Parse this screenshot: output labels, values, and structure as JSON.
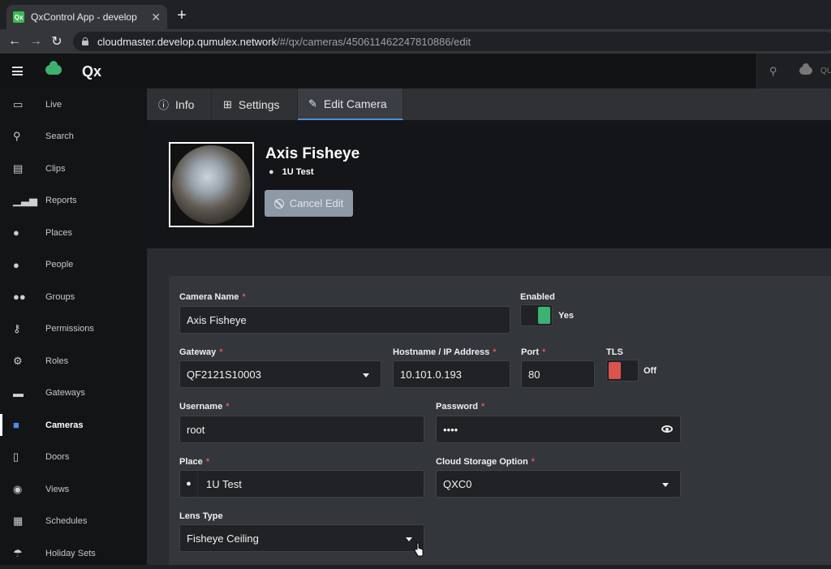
{
  "browser": {
    "tab_title": "QxControl App - develop",
    "tab_close": "✕",
    "new_tab": "+",
    "url_host": "cloudmaster.develop.qumulex.network",
    "url_path": "/#/qx/cameras/450611462247810886/edit"
  },
  "header": {
    "logo_text": "Qx",
    "right_text": "QU"
  },
  "sidebar": {
    "items": [
      {
        "label": "Live",
        "icon": "monitor-icon"
      },
      {
        "label": "Search",
        "icon": "search-icon"
      },
      {
        "label": "Clips",
        "icon": "file-icon"
      },
      {
        "label": "Reports",
        "icon": "chart-icon"
      },
      {
        "label": "Places",
        "icon": "map-pin-icon"
      },
      {
        "label": "People",
        "icon": "person-icon"
      },
      {
        "label": "Groups",
        "icon": "users-icon"
      },
      {
        "label": "Permissions",
        "icon": "key-icon"
      },
      {
        "label": "Roles",
        "icon": "user-cog-icon"
      },
      {
        "label": "Gateways",
        "icon": "hdd-icon"
      },
      {
        "label": "Cameras",
        "icon": "video-icon",
        "active": true
      },
      {
        "label": "Doors",
        "icon": "door-icon"
      },
      {
        "label": "Views",
        "icon": "eye-icon"
      },
      {
        "label": "Schedules",
        "icon": "calendar-icon"
      },
      {
        "label": "Holiday Sets",
        "icon": "umbrella-icon"
      }
    ]
  },
  "tabs": [
    {
      "label": "Info",
      "icon": "info-icon"
    },
    {
      "label": "Settings",
      "icon": "sitemap-icon"
    },
    {
      "label": "Edit Camera",
      "icon": "edit-icon",
      "active": true
    }
  ],
  "camera": {
    "name": "Axis Fisheye",
    "place": "1U Test",
    "cancel_label": "Cancel Edit"
  },
  "form": {
    "camera_name": {
      "label": "Camera Name",
      "value": "Axis Fisheye"
    },
    "enabled": {
      "label": "Enabled",
      "state": "Yes",
      "on": true
    },
    "gateway": {
      "label": "Gateway",
      "value": "QF2121S10003"
    },
    "hostname": {
      "label": "Hostname / IP Address",
      "value": "10.101.0.193"
    },
    "port": {
      "label": "Port",
      "value": "80"
    },
    "tls": {
      "label": "TLS",
      "state": "Off",
      "on": false
    },
    "username": {
      "label": "Username",
      "value": "root"
    },
    "password": {
      "label": "Password",
      "value": "••••"
    },
    "place": {
      "label": "Place",
      "value": "1U Test"
    },
    "cloud_storage": {
      "label": "Cloud Storage Option",
      "value": "QXC0"
    },
    "lens_type": {
      "label": "Lens Type",
      "value": "Fisheye Ceiling"
    },
    "required_mark": "*"
  },
  "colors": {
    "accent": "#4a8fe0",
    "toggle_on": "#3cb371",
    "toggle_off": "#d9534f",
    "required": "#e05555"
  }
}
